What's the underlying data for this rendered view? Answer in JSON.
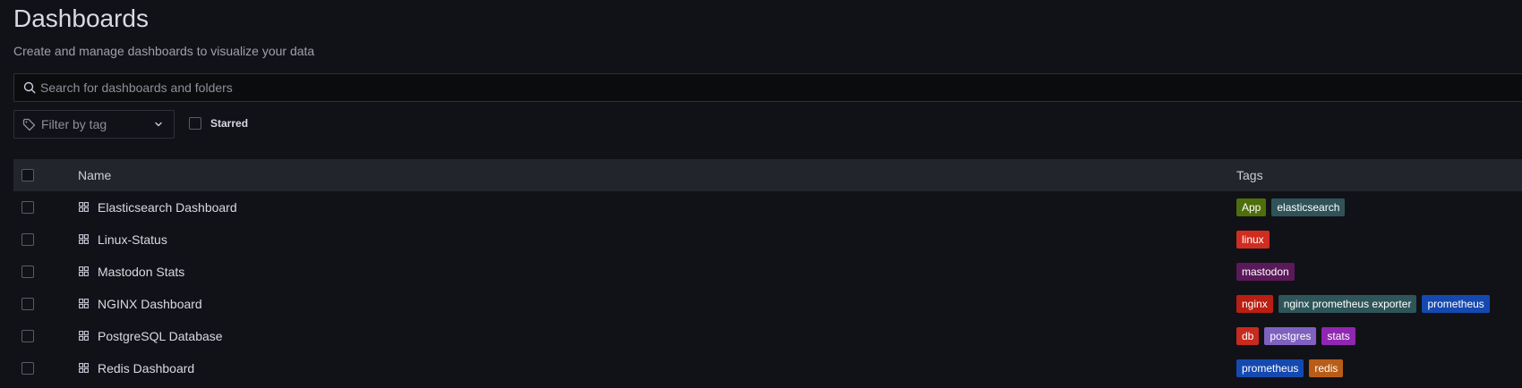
{
  "header": {
    "title": "Dashboards",
    "subtitle": "Create and manage dashboards to visualize your data"
  },
  "search": {
    "placeholder": "Search for dashboards and folders",
    "value": ""
  },
  "filters": {
    "tag_filter_placeholder": "Filter by tag",
    "starred_label": "Starred",
    "starred_checked": false
  },
  "table": {
    "columns": [
      "Name",
      "Tags"
    ],
    "rows": [
      {
        "name": "Elasticsearch Dashboard",
        "tags": [
          {
            "label": "App",
            "color": "#4f6e0c"
          },
          {
            "label": "elasticsearch",
            "color": "#2f5358"
          }
        ]
      },
      {
        "name": "Linux-Status",
        "tags": [
          {
            "label": "linux",
            "color": "#cf2d20"
          }
        ]
      },
      {
        "name": "Mastodon Stats",
        "tags": [
          {
            "label": "mastodon",
            "color": "#5a1a5a"
          }
        ]
      },
      {
        "name": "NGINX Dashboard",
        "tags": [
          {
            "label": "nginx",
            "color": "#b91f12"
          },
          {
            "label": "nginx prometheus exporter",
            "color": "#2e5559"
          },
          {
            "label": "prometheus",
            "color": "#1549b0"
          }
        ]
      },
      {
        "name": "PostgreSQL Database",
        "tags": [
          {
            "label": "db",
            "color": "#c72a1e"
          },
          {
            "label": "postgres",
            "color": "#7f61bf"
          },
          {
            "label": "stats",
            "color": "#9027b2"
          }
        ]
      },
      {
        "name": "Redis Dashboard",
        "tags": [
          {
            "label": "prometheus",
            "color": "#1549b0"
          },
          {
            "label": "redis",
            "color": "#b85d17"
          }
        ]
      }
    ]
  },
  "icons": {
    "search": "search-icon",
    "tag": "tag-icon",
    "chevron": "chevron-down-icon",
    "dashboard": "dashboard-grid-icon"
  }
}
